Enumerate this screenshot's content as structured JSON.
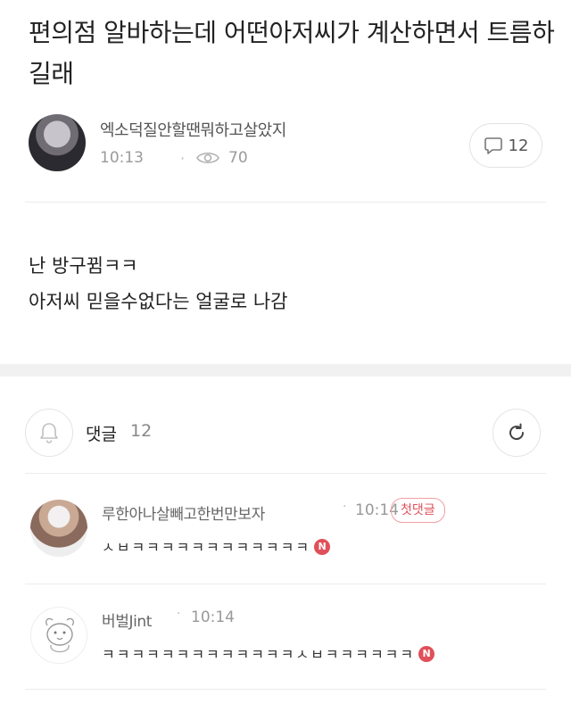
{
  "post": {
    "title": "편의점 알바하는데 어떤아저씨가 계산하면서 트름하길래",
    "author": "엑소덕질안할땐뭐하고살았지",
    "time": "10:13",
    "separator": "·",
    "views": "70",
    "comment_count": "12",
    "body_lines": [
      "난 방구뀜ㅋㅋ",
      "아저씨 믿을수없다는 얼굴로 나감"
    ]
  },
  "comments_section": {
    "label": "댓글",
    "count": "12"
  },
  "comments": [
    {
      "author": "루한아나살빼고한번만보자",
      "separator": "·",
      "time": "10:14",
      "badge": "첫댓글",
      "text": "ㅅㅂㅋㅋㅋㅋㅋㅋㅋㅋㅋㅋㅋㅋ",
      "new_badge": "N"
    },
    {
      "author": "버벌Jint",
      "separator": "·",
      "time": "10:14",
      "text": "ㅋㅋㅋㅋㅋㅋㅋㅋㅋㅋㅋㅋㅋㅅㅂㅋㅋㅋㅋㅋㅋ",
      "new_badge": "N"
    }
  ],
  "colors": {
    "accent_red": "#e0505a",
    "muted_text": "#999999",
    "divider": "#ececec"
  },
  "icons": [
    "view-eye-icon",
    "comment-bubble-icon",
    "bell-icon",
    "refresh-icon"
  ]
}
